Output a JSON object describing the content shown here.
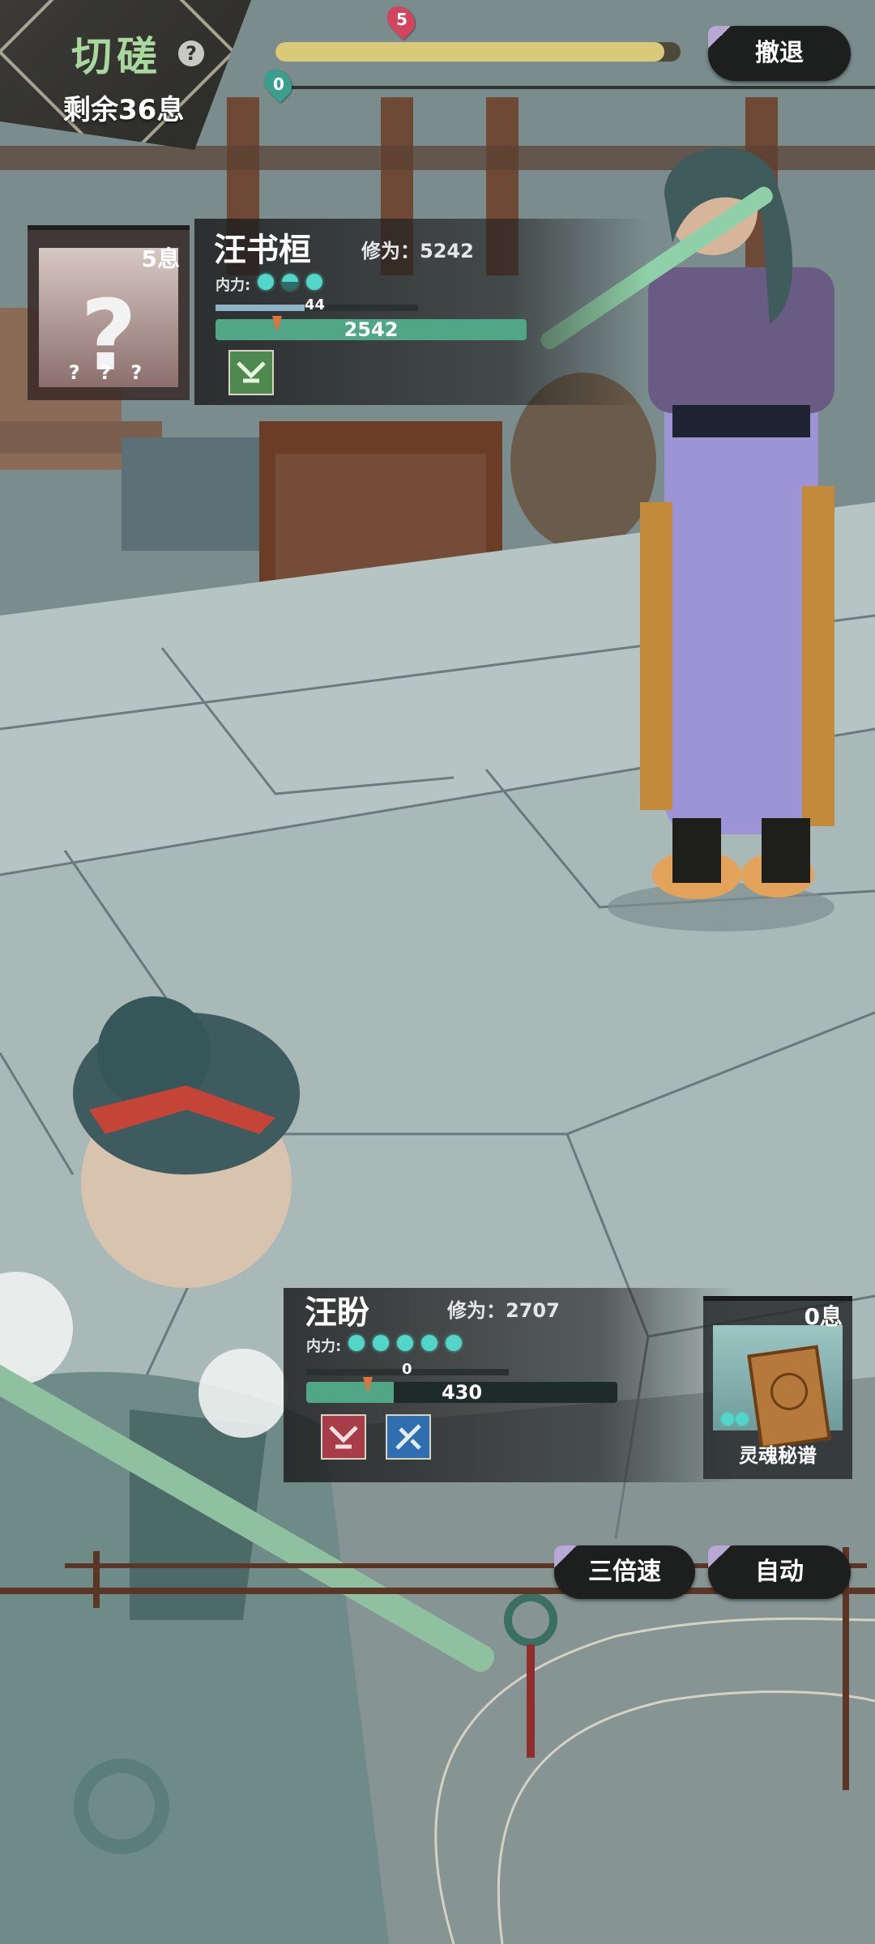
{
  "mode": {
    "title": "切磋",
    "remaining": "剩余36息"
  },
  "progress": {
    "value": 0.96,
    "start_label": "0",
    "end_label": "5"
  },
  "buttons": {
    "retreat": "撤退",
    "speed": "三倍速",
    "auto": "自动"
  },
  "enemy": {
    "card_name": "? ? ?",
    "card_xi": "5息",
    "name": "汪书桓",
    "cultivation": "修为：5242",
    "neili_label": "内力:",
    "neili_orbs": [
      1,
      0.5,
      1
    ],
    "qi_value": "44",
    "qi_fraction": 0.44,
    "hp": "2542",
    "hp_fraction": 1.0
  },
  "player": {
    "name": "汪盼",
    "cultivation": "修为：2707",
    "neili_label": "内力:",
    "neili_orbs": [
      1,
      1,
      1,
      1,
      1
    ],
    "qi_value": "0",
    "qi_fraction": 0.0,
    "hp": "430",
    "hp_fraction": 0.28,
    "scroll_xi": "0息",
    "scroll_name": "灵魂秘谱"
  },
  "colors": {
    "accent_green": "#a9d89f",
    "hp_green": "#52a688",
    "orb_teal": "#52d6c8",
    "progress_gold": "#d9c97a",
    "button_dark": "#1d1f1e"
  }
}
